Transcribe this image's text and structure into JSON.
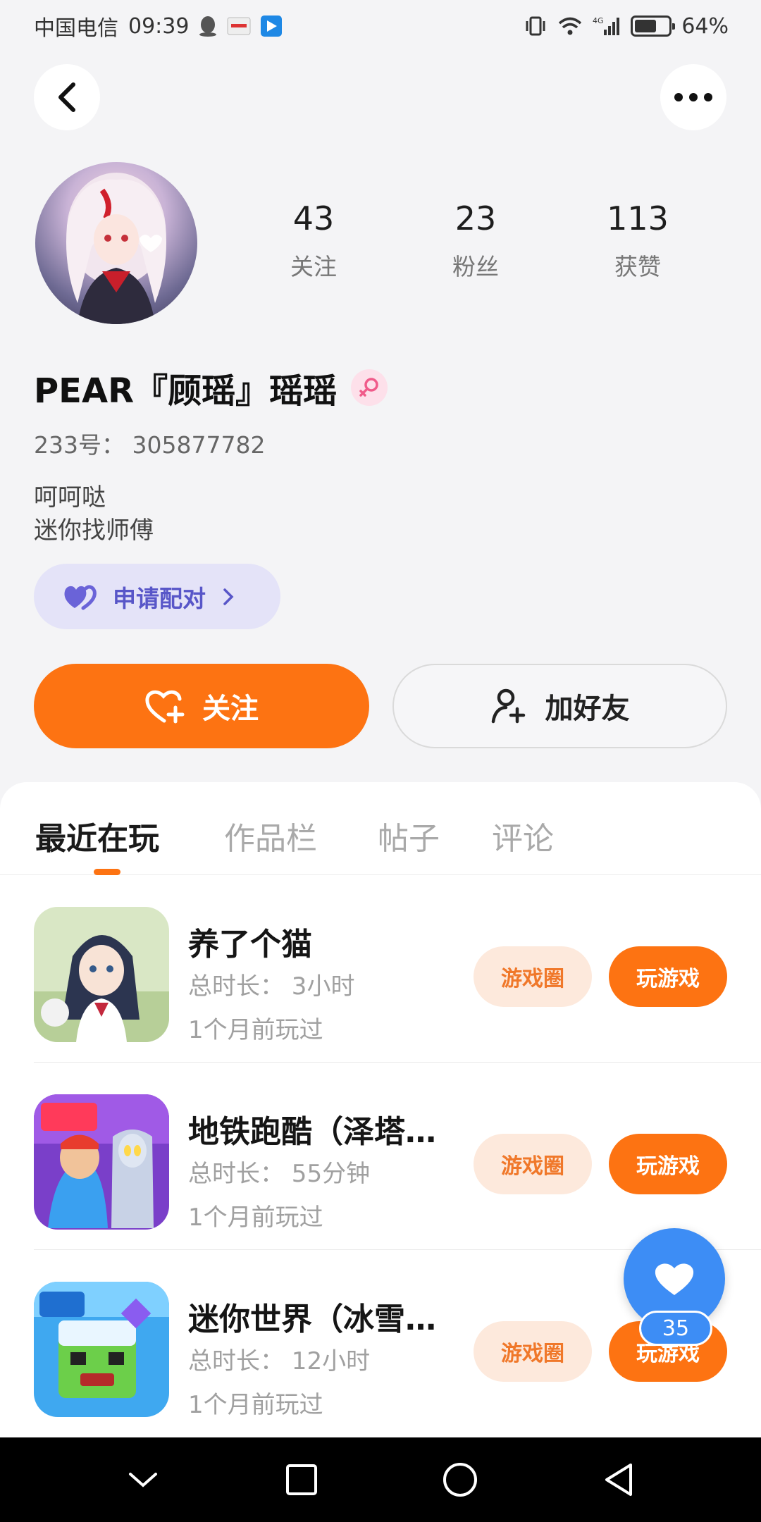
{
  "status_bar": {
    "carrier": "中国电信",
    "time": "09:39",
    "network": "4G",
    "battery": "64%",
    "battery_level": 0.64
  },
  "header": {
    "back_icon": "chevron-left-icon",
    "more_icon": "more-horizontal-icon"
  },
  "profile": {
    "nickname": "PEAR『顾瑶』瑶瑶",
    "gender": "female",
    "uid": "233号： 305877782",
    "bio_line1": "呵呵哒",
    "bio_line2": "迷你找师傅",
    "stats": [
      {
        "value": "43",
        "label": "关注"
      },
      {
        "value": "23",
        "label": "粉丝"
      },
      {
        "value": "113",
        "label": "获赞"
      }
    ],
    "match_button": "申请配对",
    "follow_button": "关注",
    "add_friend_button": "加好友"
  },
  "tabs": [
    {
      "label": "最近在玩",
      "active": true
    },
    {
      "label": "作品栏",
      "active": false
    },
    {
      "label": "帖子",
      "active": false
    },
    {
      "label": "评论",
      "active": false
    }
  ],
  "games": [
    {
      "title": "养了个猫",
      "duration": "总时长： 3小时",
      "last_played": "1个月前玩过",
      "circle_button": "游戏圈",
      "play_button": "玩游戏"
    },
    {
      "title": "地铁跑酷（泽塔…",
      "duration": "总时长： 55分钟",
      "last_played": "1个月前玩过",
      "circle_button": "游戏圈",
      "play_button": "玩游戏"
    },
    {
      "title": "迷你世界（冰雪…",
      "duration": "总时长： 12小时",
      "last_played": "1个月前玩过",
      "circle_button": "游戏圈",
      "play_button": "玩游戏"
    }
  ],
  "floating_like": {
    "count": "35"
  },
  "colors": {
    "accent_orange": "#fd7312",
    "match_purple": "#5856c8",
    "like_blue": "#3d8df5"
  }
}
